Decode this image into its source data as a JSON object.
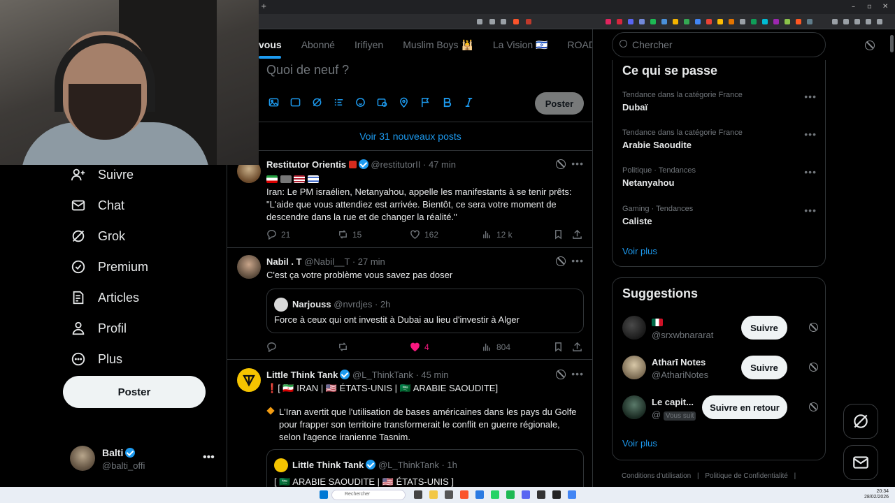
{
  "tabs": [
    "vous",
    "Abonné",
    "Irifiyen",
    "Muslim Boys 🕌",
    "La Vision 🇮🇱",
    "ROAD"
  ],
  "compose": {
    "placeholder": "Quoi de neuf ?",
    "post_label": "Poster",
    "icons": [
      "image-icon",
      "gif-icon",
      "grok-icon",
      "poll-icon",
      "emoji-icon",
      "schedule-icon",
      "location-icon",
      "flag-icon",
      "bold-icon",
      "italic-icon"
    ]
  },
  "new_posts_label": "Voir 31 nouveaux posts",
  "nav": [
    {
      "label": "Suivre",
      "icon": "follow-icon"
    },
    {
      "label": "Chat",
      "icon": "mail-icon"
    },
    {
      "label": "Grok",
      "icon": "grok-icon"
    },
    {
      "label": "Premium",
      "icon": "premium-icon"
    },
    {
      "label": "Articles",
      "icon": "articles-icon"
    },
    {
      "label": "Profil",
      "icon": "profile-icon"
    },
    {
      "label": "Plus",
      "icon": "more-circle-icon"
    }
  ],
  "poster_label": "Poster",
  "account": {
    "name": "Balti",
    "handle": "@balti_offi"
  },
  "tweets": [
    {
      "name": "Restitutor Orientis",
      "handle": "@restitutorII",
      "time": "· 47 min",
      "body": "Iran: Le PM israélien, Netanyahou, appelle les manifestants à se tenir prêts: \"L'aide que vous attendiez est arrivée. Bientôt, ce sera votre moment de descendre dans la rue et de changer la réalité.\"",
      "replies": "21",
      "reposts": "15",
      "likes": "162",
      "views": "12 k"
    },
    {
      "name": "Nabil . T",
      "handle": "@Nabil__T",
      "time": "· 27 min",
      "body": "C'est ça votre problème vous savez pas doser",
      "quote": {
        "name": "Narjouss",
        "handle": "@nvrdjes",
        "time": "· 2h",
        "body": "Force à ceux qui ont investit à Dubai au lieu d'investir à Alger"
      },
      "replies": "",
      "reposts": "",
      "likes": "4",
      "views": "804"
    },
    {
      "name": "Little Think Tank",
      "handle": "@L_ThinkTank",
      "time": "· 45 min",
      "line1": "[ 🇮🇷 IRAN | 🇺🇸 ÉTATS-UNIS | 🇸🇦 ARABIE SAOUDITE]",
      "body": "L'Iran avertit que l'utilisation de bases américaines dans les pays du Golfe pour frapper son territoire transformerait le conflit en guerre régionale, selon l'agence iranienne Tasnim.",
      "quote": {
        "name": "Little Think Tank",
        "handle": "@L_ThinkTank",
        "time": "· 1h",
        "body": "[ 🇸🇦 ARABIE SAOUDITE | 🇺🇸 ÉTATS-UNIS ]"
      }
    }
  ],
  "search_placeholder": "Chercher",
  "trends": {
    "title": "Ce qui se passe",
    "items": [
      {
        "category": "Tendance dans la catégorie France",
        "topic": "Dubaï"
      },
      {
        "category": "Tendance dans la catégorie France",
        "topic": "Arabie Saoudite"
      },
      {
        "category": "Politique · Tendances",
        "topic": "Netanyahou"
      },
      {
        "category": "Gaming · Tendances",
        "topic": "Caliste"
      }
    ],
    "more": "Voir plus"
  },
  "suggestions": {
    "title": "Suggestions",
    "items": [
      {
        "name": "🇲🇽",
        "handle": "@srxwbnararat",
        "button": "Suivre"
      },
      {
        "name": "Atharī Notes",
        "handle": "@AthariNotes",
        "button": "Suivre"
      },
      {
        "name": "Le capit...",
        "handle": "@",
        "badge": "Vous suit",
        "button": "Suivre en retour"
      }
    ],
    "more": "Voir plus"
  },
  "footer": [
    "Conditions d'utilisation",
    "Politique de Confidentialité"
  ],
  "taskbar": {
    "search": "Rechercher",
    "time": "20:34",
    "date": "28/02/2026"
  }
}
